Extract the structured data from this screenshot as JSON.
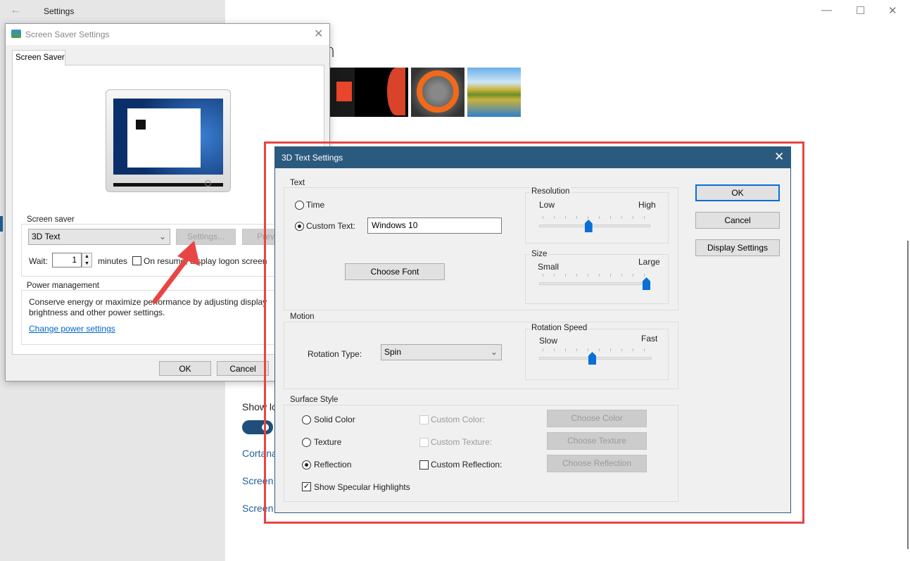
{
  "settings_window": {
    "title": "Settings",
    "page_heading_fragment": "n",
    "background_labels": [
      "Show lo",
      "Cortana",
      "Screen",
      "Screen"
    ],
    "toggle_on": true,
    "window_controls": {
      "minimize": "—",
      "maximize": "☐",
      "close": "✕"
    },
    "back_icon": "←"
  },
  "screen_saver_dialog": {
    "title": "Screen Saver Settings",
    "close_icon": "✕",
    "tab": "Screen Saver",
    "screen_saver_group": {
      "label": "Screen saver",
      "selected": "3D Text",
      "settings_button": "Settings...",
      "preview_button": "Preview",
      "wait_label": "Wait:",
      "wait_value": "1",
      "minutes_label": "minutes",
      "on_resume_label": "On resume, display logon screen",
      "on_resume_checked": false
    },
    "power_group": {
      "label": "Power management",
      "description": "Conserve energy or maximize performance by adjusting display brightness and other power settings.",
      "link": "Change power settings"
    },
    "ok_button": "OK",
    "cancel_button": "Cancel"
  },
  "text3d_dialog": {
    "title": "3D Text Settings",
    "close_icon": "✕",
    "text_group": {
      "label": "Text",
      "time_label": "Time",
      "custom_text_label": "Custom Text:",
      "selected": "custom",
      "custom_text_value": "Windows 10",
      "choose_font": "Choose Font"
    },
    "resolution": {
      "label": "Resolution",
      "min_label": "Low",
      "max_label": "High",
      "value_fraction": 0.44
    },
    "size": {
      "label": "Size",
      "min_label": "Small",
      "max_label": "Large",
      "value_fraction": 1.0
    },
    "motion_group": {
      "label": "Motion",
      "rotation_type_label": "Rotation Type:",
      "rotation_type_value": "Spin"
    },
    "rotation_speed": {
      "label": "Rotation Speed",
      "min_label": "Slow",
      "max_label": "Fast",
      "value_fraction": 0.47
    },
    "surface_group": {
      "label": "Surface Style",
      "solid_color": "Solid Color",
      "texture": "Texture",
      "reflection": "Reflection",
      "selected": "reflection",
      "custom_color": "Custom Color:",
      "custom_texture": "Custom Texture:",
      "custom_reflection": "Custom Reflection:",
      "custom_reflection_checked": false,
      "choose_color": "Choose Color",
      "choose_texture": "Choose Texture",
      "choose_reflection": "Choose Reflection",
      "show_specular": "Show Specular Highlights",
      "show_specular_checked": true
    },
    "ok_button": "OK",
    "cancel_button": "Cancel",
    "display_settings_button": "Display Settings"
  },
  "annotation": {
    "highlight_color": "#e84545"
  }
}
